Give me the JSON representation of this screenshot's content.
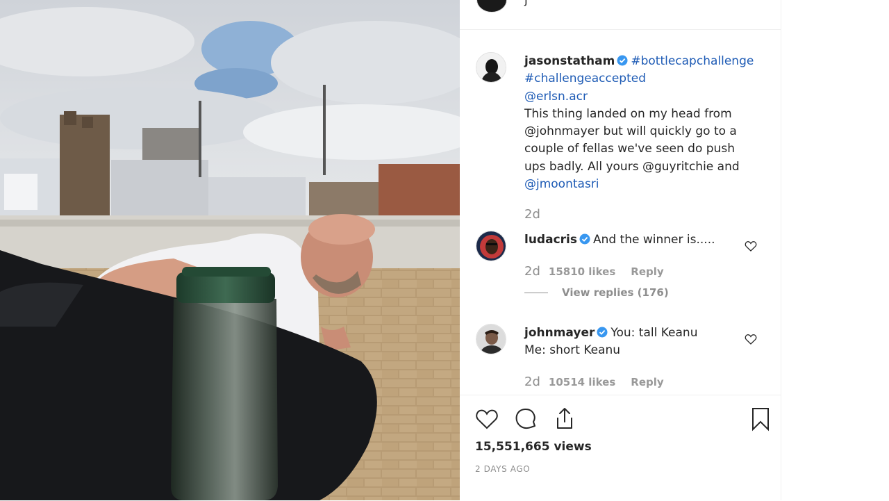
{
  "post": {
    "top_username_partial": "j",
    "caption": {
      "username": "jasonstatham",
      "lines": [
        "#bottlecapchallenge",
        "#challengeaccepted",
        "@erlsn.acr",
        "This thing landed on my head from",
        "@johnmayer but will quickly go to a",
        "couple of fellas we've seen do push",
        "ups badly. All yours @guyritchie and",
        "@jmoontasri"
      ],
      "age": "2d"
    },
    "comments": [
      {
        "username": "ludacris",
        "lines": [
          "And the winner is....."
        ],
        "age": "2d",
        "likes": "15810 likes",
        "reply_label": "Reply",
        "view_replies": "View replies (176)"
      },
      {
        "username": "johnmayer",
        "lines": [
          "You: tall Keanu",
          "Me: short Keanu"
        ],
        "age": "2d",
        "likes": "10514 likes",
        "reply_label": "Reply"
      }
    ],
    "views": "15,551,665 views",
    "posted": "2 DAYS AGO"
  },
  "icons": {
    "like": "heart-icon",
    "comment": "comment-icon",
    "share": "share-icon",
    "save": "bookmark-icon",
    "verified": "verified-badge-icon"
  },
  "colors": {
    "link": "#1e5bb5",
    "verified": "#3897f0",
    "muted": "#8e8e8e",
    "text": "#262626"
  }
}
